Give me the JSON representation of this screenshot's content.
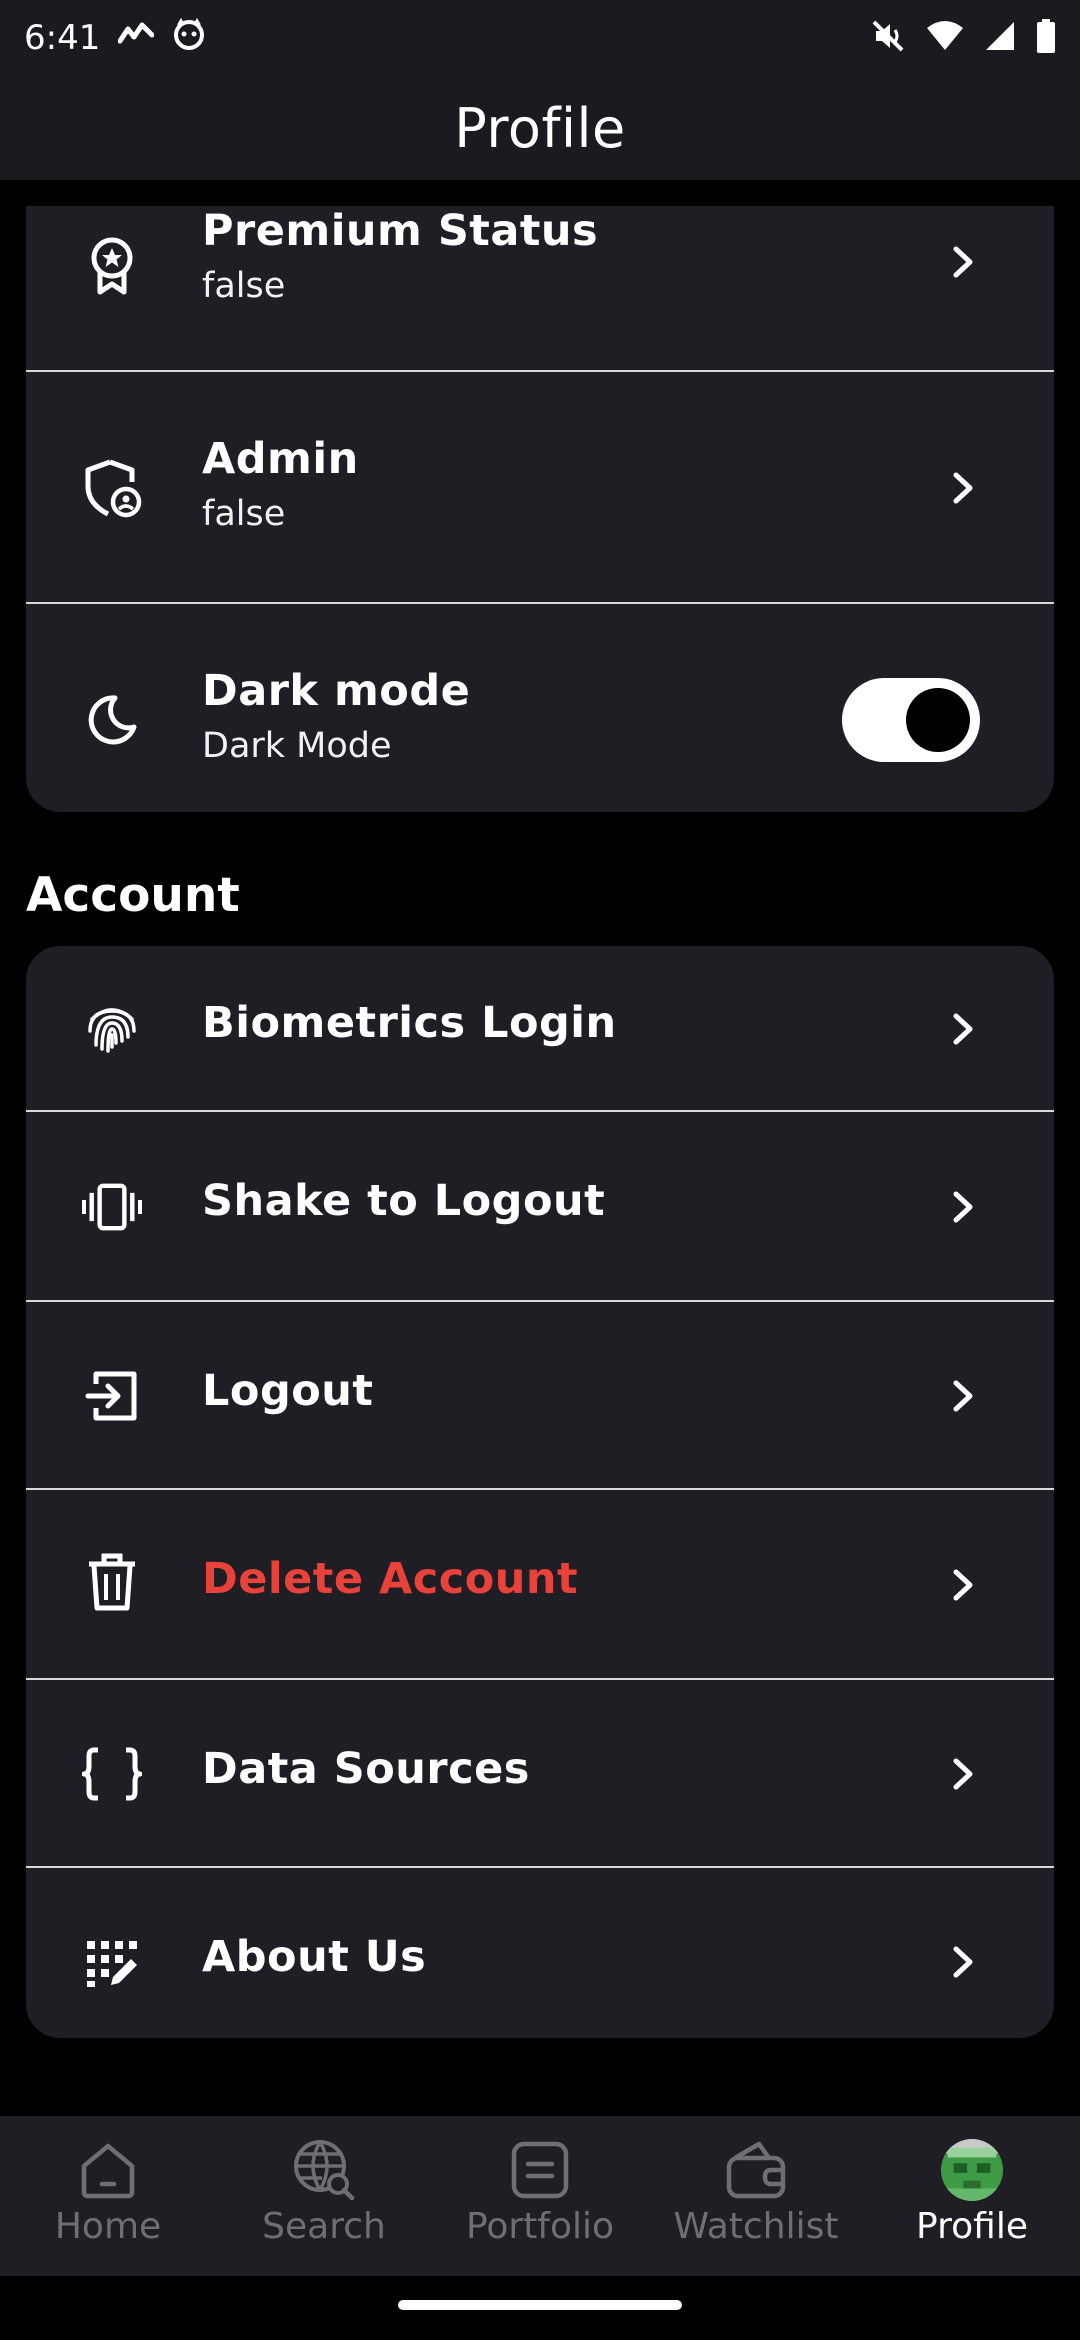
{
  "status_bar": {
    "time": "6:41"
  },
  "app_bar": {
    "title": "Profile"
  },
  "settings_card": {
    "rows": [
      {
        "title": "Premium Status",
        "subtitle": "false",
        "icon": "award-icon"
      },
      {
        "title": "Admin",
        "subtitle": "false",
        "icon": "shield-user-icon"
      },
      {
        "title": "Dark mode",
        "subtitle": "Dark Mode",
        "icon": "moon-icon",
        "toggle_on": true
      }
    ]
  },
  "account_section": {
    "title": "Account",
    "rows": [
      {
        "title": "Biometrics Login",
        "icon": "fingerprint-icon"
      },
      {
        "title": "Shake to Logout",
        "icon": "vibrate-icon"
      },
      {
        "title": "Logout",
        "icon": "logout-icon"
      },
      {
        "title": "Delete Account",
        "icon": "trash-icon",
        "color": "#e8423a"
      },
      {
        "title": "Data Sources",
        "icon": "braces-icon"
      },
      {
        "title": "About Us",
        "icon": "dots-edit-icon"
      }
    ]
  },
  "bottom_nav": {
    "items": [
      {
        "label": "Home",
        "icon": "home-icon"
      },
      {
        "label": "Search",
        "icon": "globe-search-icon"
      },
      {
        "label": "Portfolio",
        "icon": "portfolio-icon"
      },
      {
        "label": "Watchlist",
        "icon": "wallet-icon"
      },
      {
        "label": "Profile",
        "icon": "avatar-icon",
        "active": true
      }
    ]
  },
  "colors": {
    "background": "#000000",
    "surface": "#1f1e24",
    "danger": "#e8423a",
    "inactive": "#6f6e75"
  }
}
